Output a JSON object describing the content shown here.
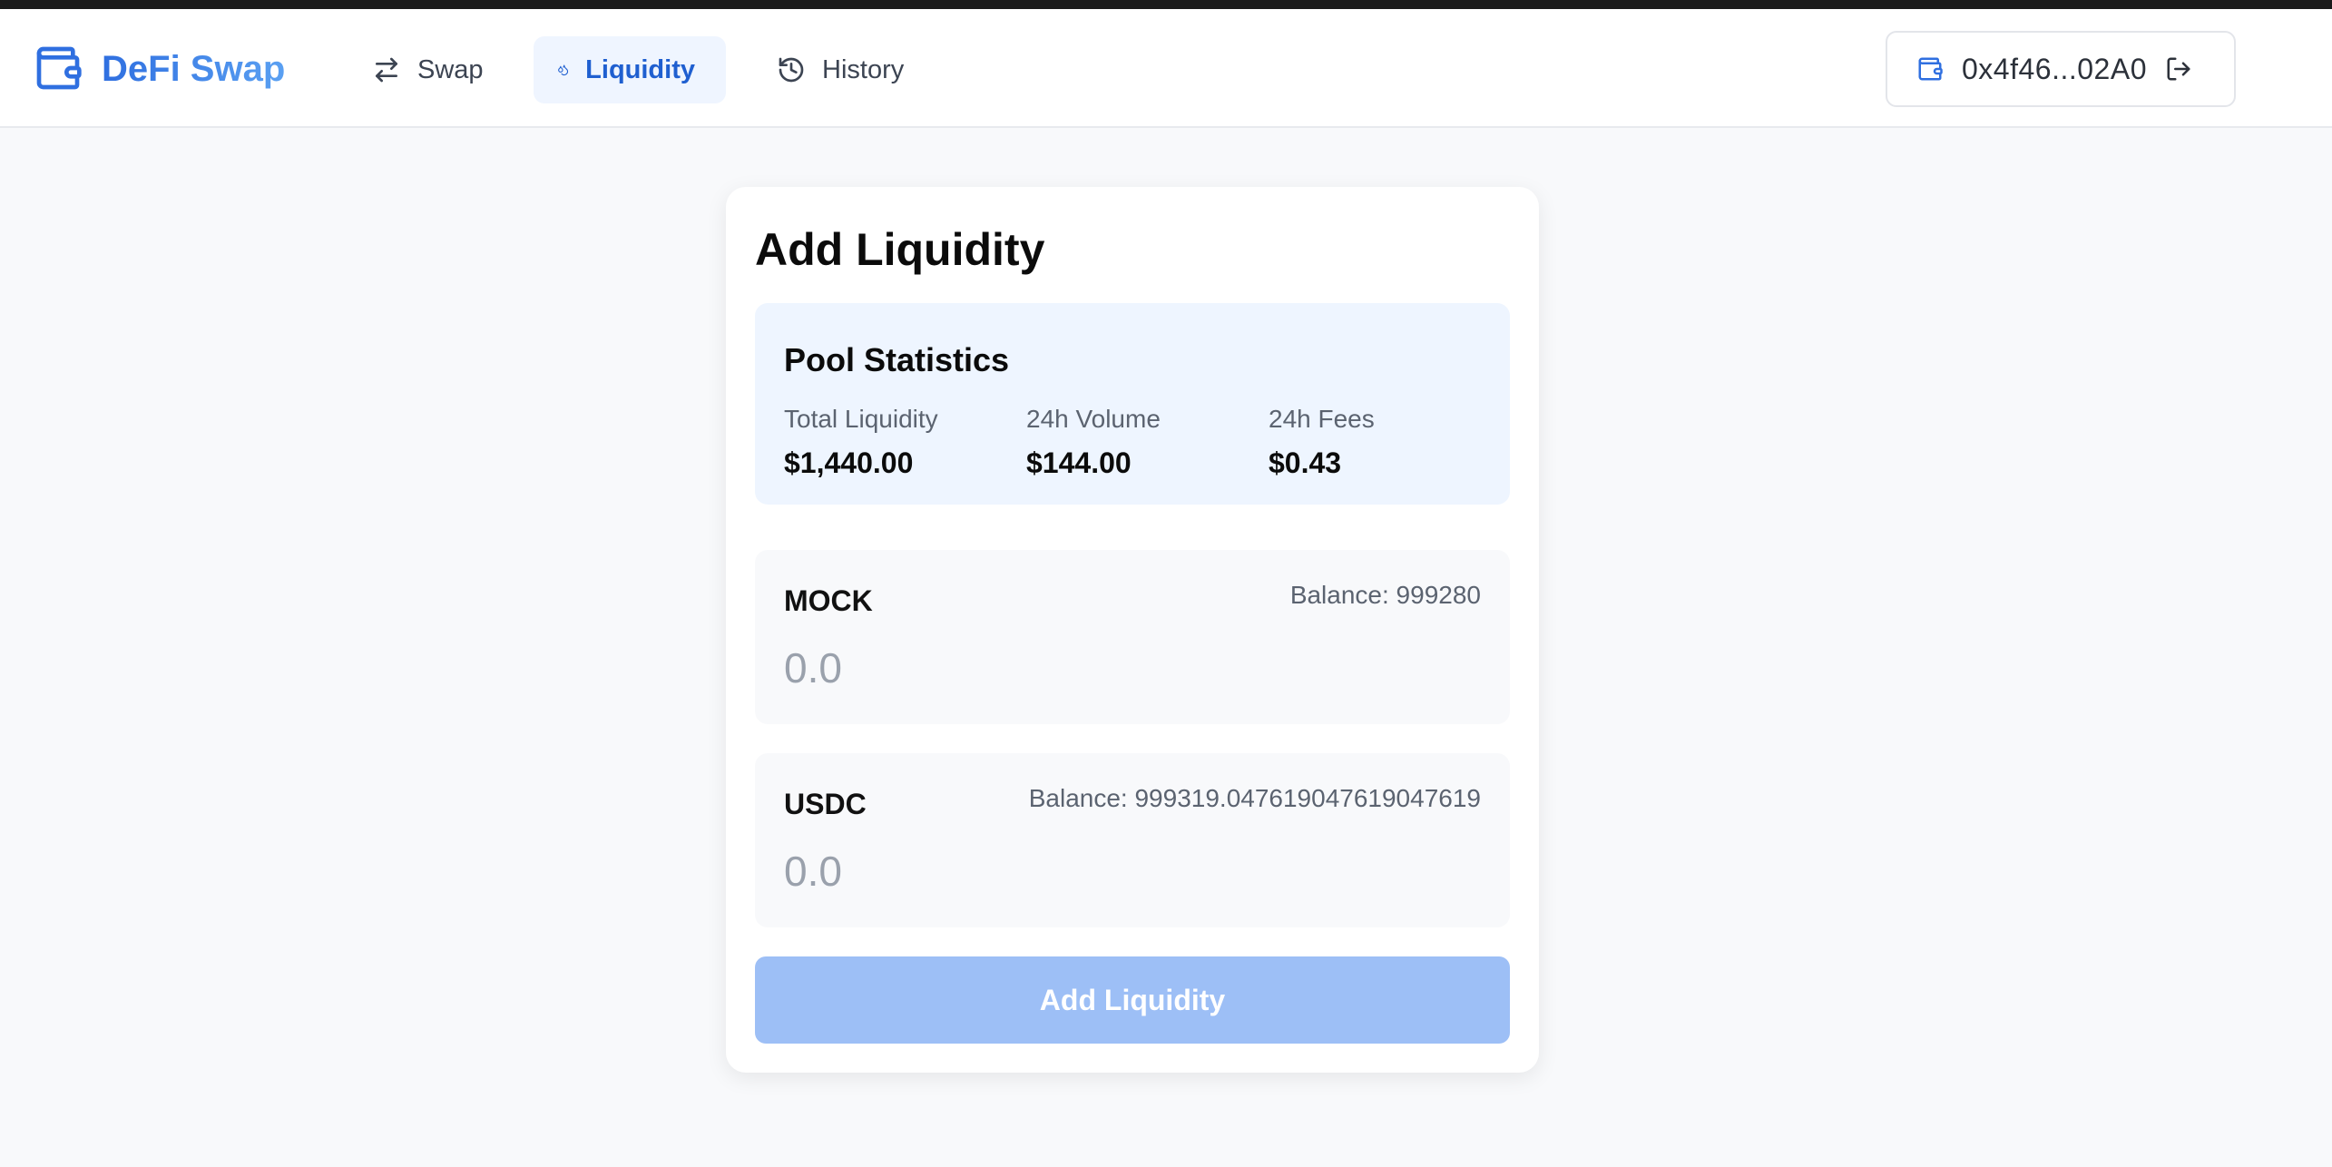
{
  "app": {
    "name": "DeFi Swap"
  },
  "nav": {
    "items": [
      {
        "label": "Swap",
        "icon": "arrows-swap-icon"
      },
      {
        "label": "Liquidity",
        "icon": "droplets-icon"
      },
      {
        "label": "History",
        "icon": "history-icon"
      }
    ],
    "active": "Liquidity"
  },
  "wallet": {
    "address": "0x4f46...02A0",
    "icon": "wallet-icon",
    "disconnect_icon": "logout-icon"
  },
  "card": {
    "title": "Add Liquidity",
    "pool_stats": {
      "title": "Pool Statistics",
      "items": [
        {
          "label": "Total Liquidity",
          "value": "$1,440.00"
        },
        {
          "label": "24h Volume",
          "value": "$144.00"
        },
        {
          "label": "24h Fees",
          "value": "$0.43"
        }
      ]
    },
    "tokens": [
      {
        "symbol": "MOCK",
        "balance": "Balance: 999280",
        "placeholder": "0.0",
        "value": ""
      },
      {
        "symbol": "USDC",
        "balance": "Balance: 999319.047619047619047619",
        "placeholder": "0.0",
        "value": ""
      }
    ],
    "submit_label": "Add Liquidity"
  },
  "colors": {
    "accent": "#2f6fe0",
    "active_nav_bg": "#eff5ff",
    "stats_bg": "#eef5ff",
    "button_disabled": "#9dbff6"
  }
}
